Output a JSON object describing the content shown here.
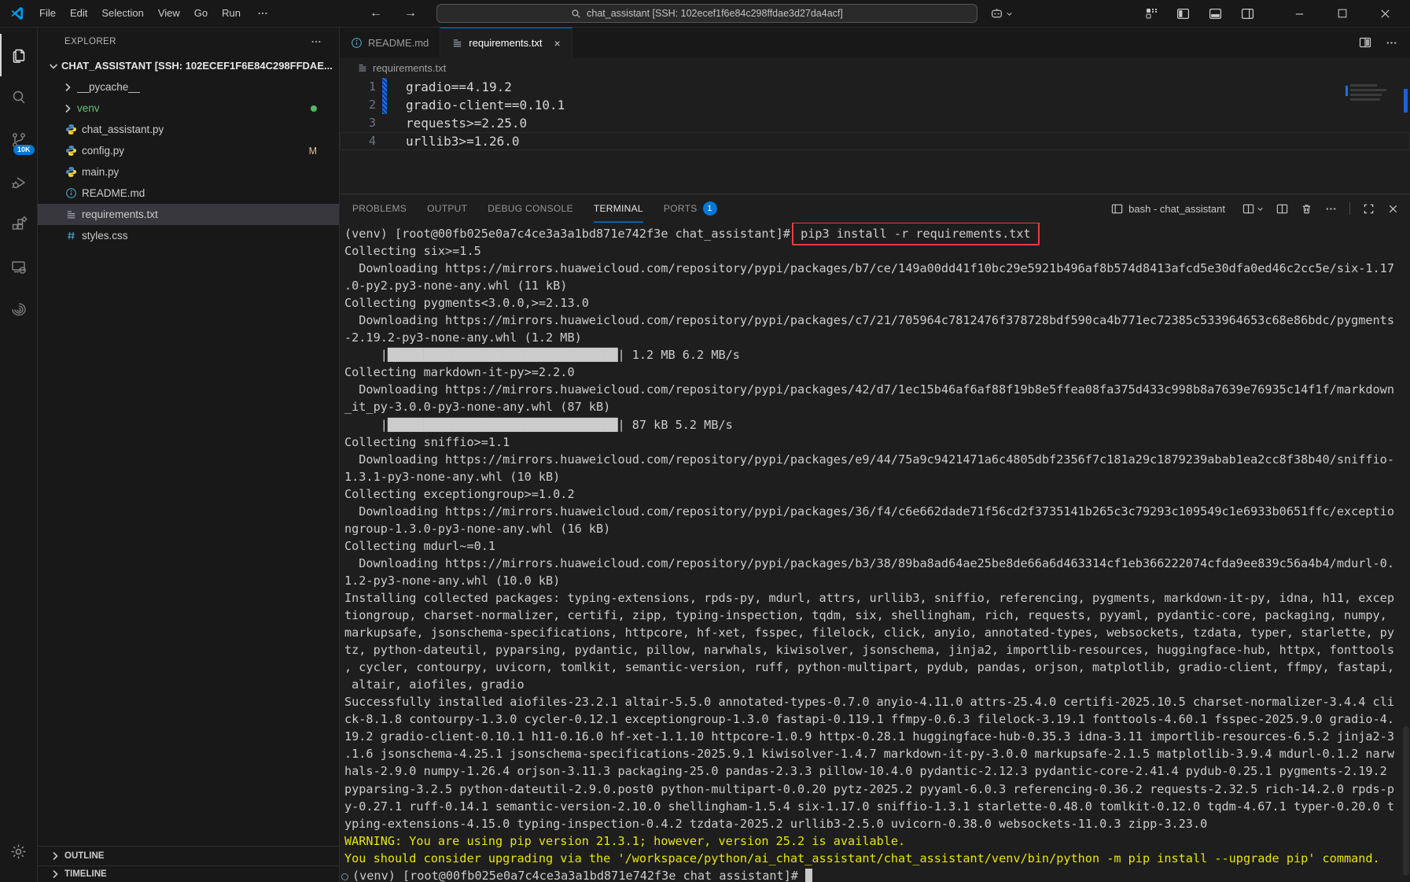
{
  "colors": {
    "accent": "#0078d4",
    "warning_text": "#e5e510",
    "annotation_red": "#ee3b3e",
    "git_modified": "#e2c08d",
    "git_added_dot": "#54b95f",
    "venv_green": "#62c174"
  },
  "titlebar": {
    "menus": [
      "File",
      "Edit",
      "Selection",
      "View",
      "Go",
      "Run"
    ],
    "search_text": "chat_assistant [SSH: 102ecef1f6e84c298ffdae3d27da4acf]"
  },
  "activitybar": {
    "scm_badge": "10K"
  },
  "sidebar": {
    "header": "EXPLORER",
    "root": "CHAT_ASSISTANT [SSH: 102ECEF1F6E84C298FFDAE...",
    "files": [
      {
        "name": "__pycache__",
        "icon": "folder"
      },
      {
        "name": "venv",
        "icon": "folder",
        "green": true,
        "dot": true
      },
      {
        "name": "chat_assistant.py",
        "icon": "python"
      },
      {
        "name": "config.py",
        "icon": "python",
        "badge": "M"
      },
      {
        "name": "main.py",
        "icon": "python"
      },
      {
        "name": "README.md",
        "icon": "info"
      },
      {
        "name": "requirements.txt",
        "icon": "list",
        "selected": true
      },
      {
        "name": "styles.css",
        "icon": "hash"
      }
    ],
    "sections": [
      "OUTLINE",
      "TIMELINE"
    ]
  },
  "editor": {
    "tabs": [
      {
        "label": "README.md",
        "icon": "info",
        "active": false
      },
      {
        "label": "requirements.txt",
        "icon": "list",
        "active": true
      }
    ],
    "breadcrumb": "requirements.txt",
    "lines": [
      {
        "num": "1",
        "text": "gradio==4.19.2",
        "modified": true
      },
      {
        "num": "2",
        "text": "gradio-client==0.10.1",
        "modified": true
      },
      {
        "num": "3",
        "text": "requests>=2.25.0"
      },
      {
        "num": "4",
        "text": "urllib3>=1.26.0",
        "current": true
      }
    ]
  },
  "panel": {
    "tabs": [
      {
        "label": "PROBLEMS"
      },
      {
        "label": "OUTPUT"
      },
      {
        "label": "DEBUG CONSOLE"
      },
      {
        "label": "TERMINAL",
        "active": true
      },
      {
        "label": "PORTS",
        "badge": "1"
      }
    ],
    "terminal_title": "bash - chat_assistant",
    "terminal": {
      "lines": [
        {
          "kind": "first",
          "prompt": "(venv) [root@00fb025e0a7c4ce3a3a1bd871e742f3e chat_assistant]# ",
          "command": "pip3 install -r requirements.txt"
        },
        {
          "kind": "out",
          "text": "Collecting six>=1.5"
        },
        {
          "kind": "out",
          "text": "  Downloading https://mirrors.huaweicloud.com/repository/pypi/packages/b7/ce/149a00dd41f10bc29e5921b496af8b574d8413afcd5e30dfa0ed46c2cc5e/six-1.17"
        },
        {
          "kind": "out",
          "text": ".0-py2.py3-none-any.whl (11 kB)"
        },
        {
          "kind": "out",
          "text": "Collecting pygments<3.0.0,>=2.13.0"
        },
        {
          "kind": "out",
          "text": "  Downloading https://mirrors.huaweicloud.com/repository/pypi/packages/c7/21/705964c7812476f378728bdf590ca4b771ec72385c533964653c68e86bdc/pygments"
        },
        {
          "kind": "out",
          "text": "-2.19.2-py3-none-any.whl (1.2 MB)"
        },
        {
          "kind": "out",
          "text": "     |████████████████████████████████| 1.2 MB 6.2 MB/s"
        },
        {
          "kind": "out",
          "text": "Collecting markdown-it-py>=2.2.0"
        },
        {
          "kind": "out",
          "text": "  Downloading https://mirrors.huaweicloud.com/repository/pypi/packages/42/d7/1ec15b46af6af88f19b8e5ffea08fa375d433c998b8a7639e76935c14f1f/markdown"
        },
        {
          "kind": "out",
          "text": "_it_py-3.0.0-py3-none-any.whl (87 kB)"
        },
        {
          "kind": "out",
          "text": "     |████████████████████████████████| 87 kB 5.2 MB/s"
        },
        {
          "kind": "out",
          "text": "Collecting sniffio>=1.1"
        },
        {
          "kind": "out",
          "text": "  Downloading https://mirrors.huaweicloud.com/repository/pypi/packages/e9/44/75a9c9421471a6c4805dbf2356f7c181a29c1879239abab1ea2cc8f38b40/sniffio-"
        },
        {
          "kind": "out",
          "text": "1.3.1-py3-none-any.whl (10 kB)"
        },
        {
          "kind": "out",
          "text": "Collecting exceptiongroup>=1.0.2"
        },
        {
          "kind": "out",
          "text": "  Downloading https://mirrors.huaweicloud.com/repository/pypi/packages/36/f4/c6e662dade71f56cd2f3735141b265c3c79293c109549c1e6933b0651ffc/exceptio"
        },
        {
          "kind": "out",
          "text": "ngroup-1.3.0-py3-none-any.whl (16 kB)"
        },
        {
          "kind": "out",
          "text": "Collecting mdurl~=0.1"
        },
        {
          "kind": "out",
          "text": "  Downloading https://mirrors.huaweicloud.com/repository/pypi/packages/b3/38/89ba8ad64ae25be8de66a6d463314cf1eb366222074cfda9ee839c56a4b4/mdurl-0."
        },
        {
          "kind": "out",
          "text": "1.2-py3-none-any.whl (10.0 kB)"
        },
        {
          "kind": "out",
          "text": "Installing collected packages: typing-extensions, rpds-py, mdurl, attrs, urllib3, sniffio, referencing, pygments, markdown-it-py, idna, h11, excep"
        },
        {
          "kind": "out",
          "text": "tiongroup, charset-normalizer, certifi, zipp, typing-inspection, tqdm, six, shellingham, rich, requests, pyyaml, pydantic-core, packaging, numpy, "
        },
        {
          "kind": "out",
          "text": "markupsafe, jsonschema-specifications, httpcore, hf-xet, fsspec, filelock, click, anyio, annotated-types, websockets, tzdata, typer, starlette, py"
        },
        {
          "kind": "out",
          "text": "tz, python-dateutil, pyparsing, pydantic, pillow, narwhals, kiwisolver, jsonschema, jinja2, importlib-resources, huggingface-hub, httpx, fonttools"
        },
        {
          "kind": "out",
          "text": ", cycler, contourpy, uvicorn, tomlkit, semantic-version, ruff, python-multipart, pydub, pandas, orjson, matplotlib, gradio-client, ffmpy, fastapi,"
        },
        {
          "kind": "out",
          "text": " altair, aiofiles, gradio"
        },
        {
          "kind": "out",
          "text": "Successfully installed aiofiles-23.2.1 altair-5.5.0 annotated-types-0.7.0 anyio-4.11.0 attrs-25.4.0 certifi-2025.10.5 charset-normalizer-3.4.4 cli"
        },
        {
          "kind": "out",
          "text": "ck-8.1.8 contourpy-1.3.0 cycler-0.12.1 exceptiongroup-1.3.0 fastapi-0.119.1 ffmpy-0.6.3 filelock-3.19.1 fonttools-4.60.1 fsspec-2025.9.0 gradio-4."
        },
        {
          "kind": "out",
          "text": "19.2 gradio-client-0.10.1 h11-0.16.0 hf-xet-1.1.10 httpcore-1.0.9 httpx-0.28.1 huggingface-hub-0.35.3 idna-3.11 importlib-resources-6.5.2 jinja2-3"
        },
        {
          "kind": "out",
          "text": ".1.6 jsonschema-4.25.1 jsonschema-specifications-2025.9.1 kiwisolver-1.4.7 markdown-it-py-3.0.0 markupsafe-2.1.5 matplotlib-3.9.4 mdurl-0.1.2 narw"
        },
        {
          "kind": "out",
          "text": "hals-2.9.0 numpy-1.26.4 orjson-3.11.3 packaging-25.0 pandas-2.3.3 pillow-10.4.0 pydantic-2.12.3 pydantic-core-2.41.4 pydub-0.25.1 pygments-2.19.2 "
        },
        {
          "kind": "out",
          "text": "pyparsing-3.2.5 python-dateutil-2.9.0.post0 python-multipart-0.0.20 pytz-2025.2 pyyaml-6.0.3 referencing-0.36.2 requests-2.32.5 rich-14.2.0 rpds-p"
        },
        {
          "kind": "out",
          "text": "y-0.27.1 ruff-0.14.1 semantic-version-2.10.0 shellingham-1.5.4 six-1.17.0 sniffio-1.3.1 starlette-0.48.0 tomlkit-0.12.0 tqdm-4.67.1 typer-0.20.0 t"
        },
        {
          "kind": "out",
          "text": "yping-extensions-4.15.0 typing-inspection-0.4.2 tzdata-2025.2 urllib3-2.5.0 uvicorn-0.38.0 websockets-11.0.3 zipp-3.23.0"
        },
        {
          "kind": "warn",
          "text": "WARNING: You are using pip version 21.3.1; however, version 25.2 is available."
        },
        {
          "kind": "warn",
          "text": "You should consider upgrading via the '/workspace/python/ai_chat_assistant/chat_assistant/venv/bin/python -m pip install --upgrade pip' command."
        },
        {
          "kind": "end",
          "prompt": "(venv) [root@00fb025e0a7c4ce3a3a1bd871e742f3e chat_assistant]# "
        }
      ]
    }
  }
}
